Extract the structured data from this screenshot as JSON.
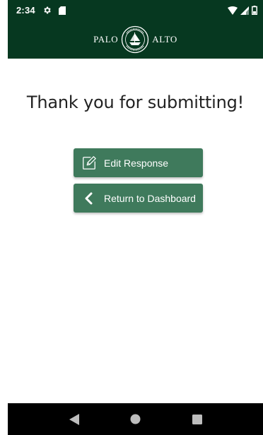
{
  "status_bar": {
    "time": "2:34",
    "icons": [
      "settings-gear-icon",
      "sd-card-icon",
      "wifi-icon",
      "cell-signal-icon",
      "battery-icon"
    ]
  },
  "header": {
    "brand_left": "PALO",
    "brand_right": "ALTO",
    "seal_icon": "palo-alto-seal-icon"
  },
  "main": {
    "heading": "Thank you for submitting!",
    "buttons": [
      {
        "label": "Edit Response",
        "icon": "edit-icon"
      },
      {
        "label": "Return to Dashboard",
        "icon": "chevron-left-icon"
      }
    ]
  },
  "nav_bar": {
    "icons": [
      "back-triangle-icon",
      "home-circle-icon",
      "recents-square-icon"
    ]
  },
  "colors": {
    "header_bg": "#063820",
    "button_bg": "#3f7a5c",
    "nav_bg": "#000000"
  }
}
